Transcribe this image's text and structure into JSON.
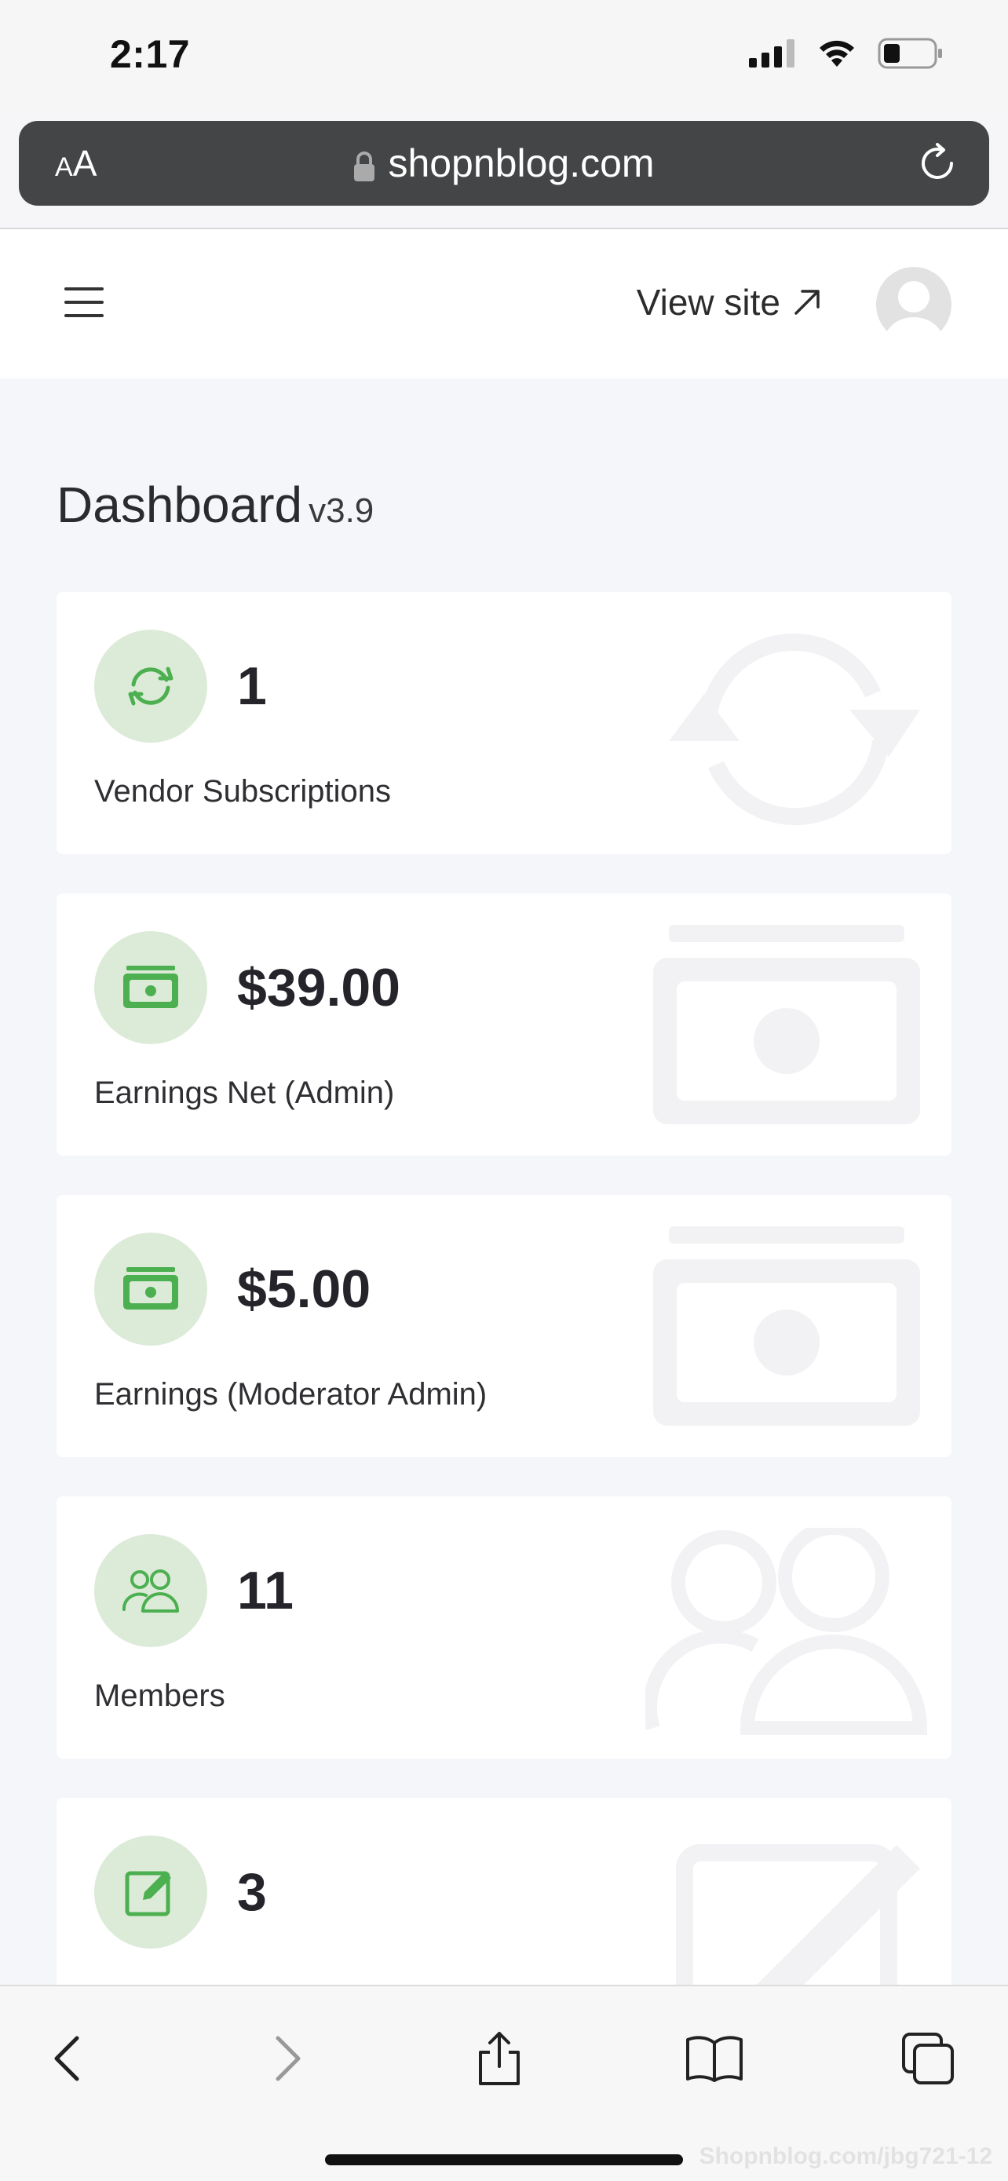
{
  "status_bar": {
    "time": "2:17"
  },
  "browser": {
    "text_size_small": "A",
    "text_size_large": "A",
    "url": "shopnblog.com"
  },
  "header": {
    "view_site_label": "View site"
  },
  "page": {
    "title": "Dashboard",
    "version": "v3.9"
  },
  "cards": [
    {
      "value": "1",
      "label": "Vendor Subscriptions",
      "icon": "refresh-icon"
    },
    {
      "value": "$39.00",
      "label": "Earnings Net (Admin)",
      "icon": "money-bill-icon"
    },
    {
      "value": "$5.00",
      "label": "Earnings (Moderator Admin)",
      "icon": "money-bill-icon"
    },
    {
      "value": "11",
      "label": "Members",
      "icon": "users-icon"
    },
    {
      "value": "3",
      "label": "",
      "icon": "edit-icon"
    }
  ],
  "watermark": "Shopnblog.com/jbg721-12",
  "colors": {
    "accent_green": "#4caf50",
    "icon_bg": "#dcebd8",
    "address_bar": "#444546"
  }
}
